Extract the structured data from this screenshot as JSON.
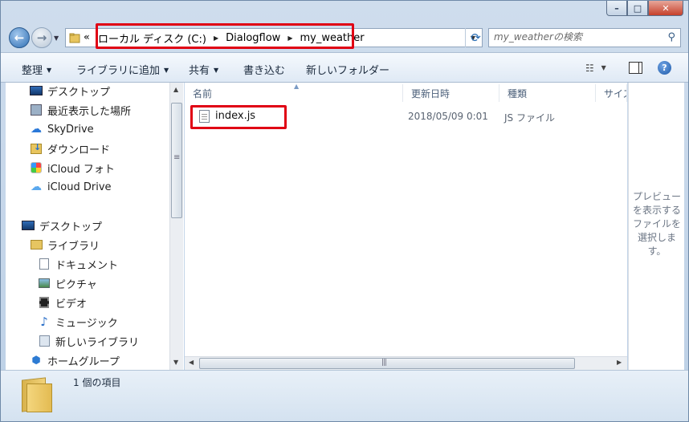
{
  "window": {
    "controls": {
      "minimize": "–",
      "maximize": "□",
      "close": "✕"
    }
  },
  "nav": {
    "breadcrumbs": [
      "ローカル ディスク (C:)",
      "Dialogflow",
      "my_weather"
    ],
    "overflow": "«",
    "search_placeholder": "my_weatherの検索"
  },
  "toolbar": {
    "organize": "整理",
    "add_to_library": "ライブラリに追加",
    "share": "共有",
    "burn": "書き込む",
    "new_folder": "新しいフォルダー"
  },
  "sidebar": {
    "favorites": [
      "デスクトップ",
      "最近表示した場所",
      "SkyDrive",
      "ダウンロード",
      "iCloud フォト",
      "iCloud Drive"
    ],
    "desktop": "デスクトップ",
    "libraries": "ライブラリ",
    "library_items": [
      "ドキュメント",
      "ピクチャ",
      "ビデオ",
      "ミュージック",
      "新しいライブラリ"
    ],
    "homegroup": "ホームグループ"
  },
  "columns": [
    "名前",
    "更新日時",
    "種類",
    "サイズ"
  ],
  "files": [
    {
      "name": "index.js",
      "modified": "2018/05/09 0:01",
      "type": "JS ファイル"
    }
  ],
  "preview": {
    "message": "プレビューを表示するファイルを選択します。"
  },
  "status": {
    "item_count": "1 個の項目"
  },
  "colors": {
    "highlight": "#e00014",
    "accent": "#2b6fb6"
  }
}
